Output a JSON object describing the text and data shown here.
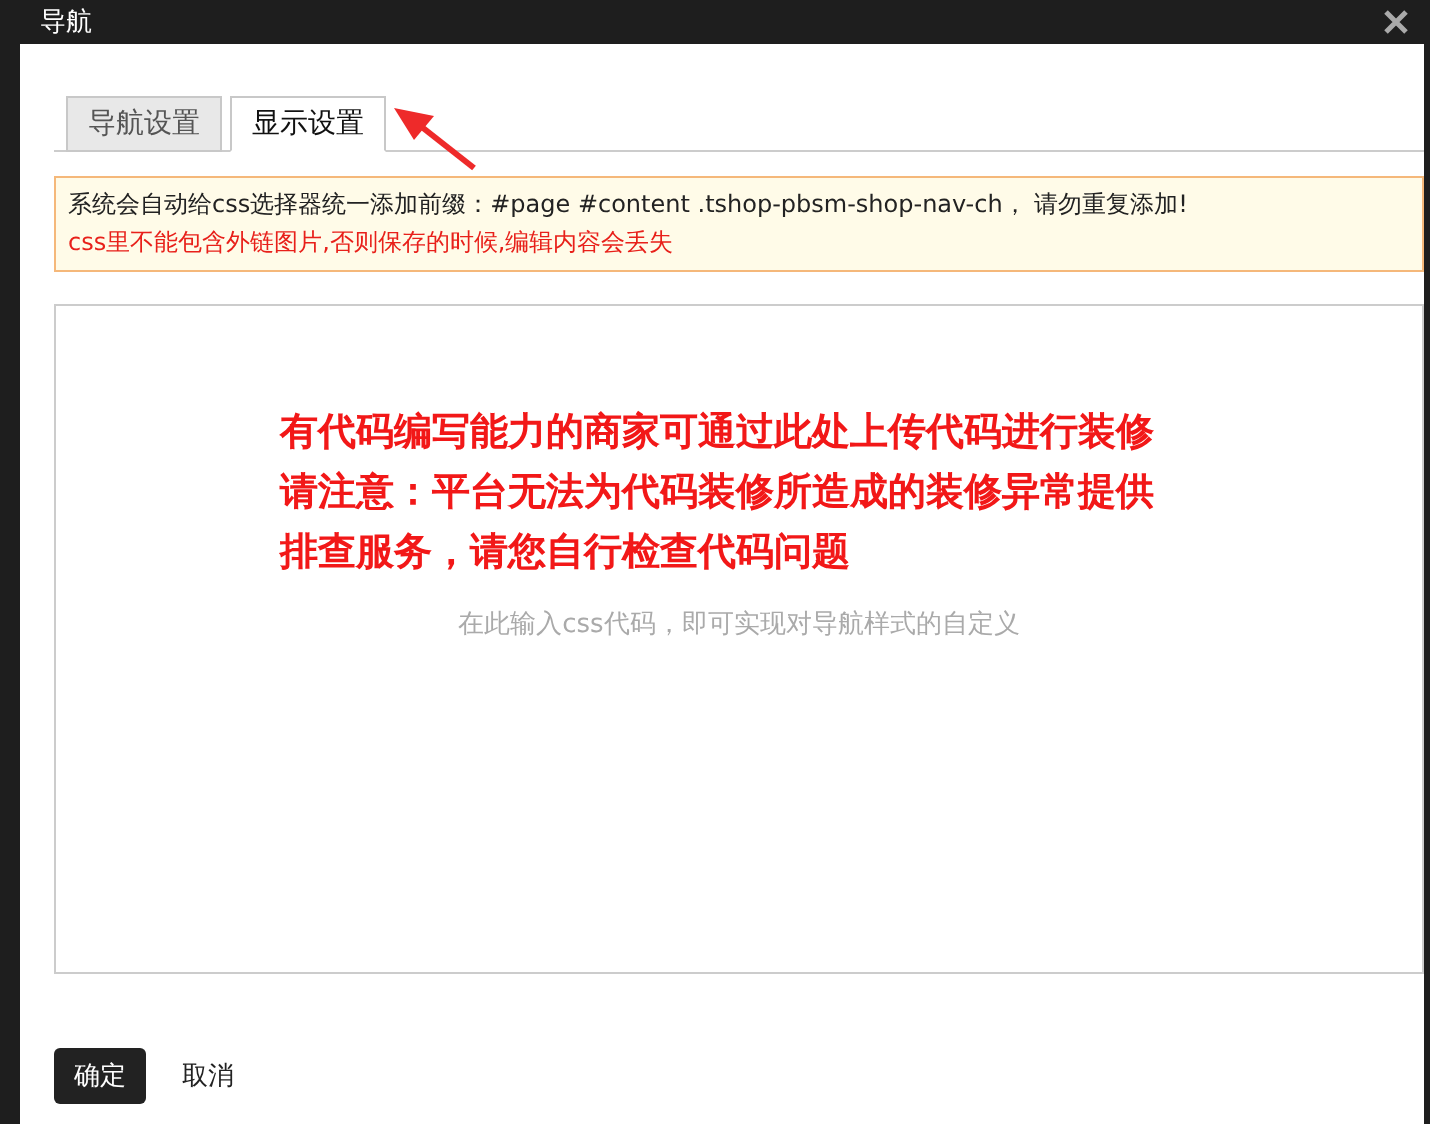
{
  "window": {
    "title": "导航"
  },
  "tabs": [
    {
      "label": "导航设置",
      "selected": false
    },
    {
      "label": "显示设置",
      "selected": true
    }
  ],
  "notice": {
    "lines": [
      {
        "text": "系统会自动给css选择器统一添加前缀：#page #content .tshop-pbsm-shop-nav-ch， 请勿重复添加!",
        "kind": "info"
      },
      {
        "text": "css里不能包含外链图片,否则保存的时候,编辑内容会丢失",
        "kind": "warning"
      }
    ]
  },
  "editor": {
    "placeholder": "在此输入css代码，即可实现对导航样式的自定义"
  },
  "annotation": {
    "lines": [
      "有代码编写能力的商家可通过此处上传代码进行装修",
      "请注意：平台无法为代码装修所造成的装修异常提供",
      "排查服务，请您自行检查代码问题"
    ]
  },
  "buttons": [
    {
      "label": "确定",
      "kind": "primary"
    },
    {
      "label": "取消",
      "kind": "plain"
    }
  ]
}
